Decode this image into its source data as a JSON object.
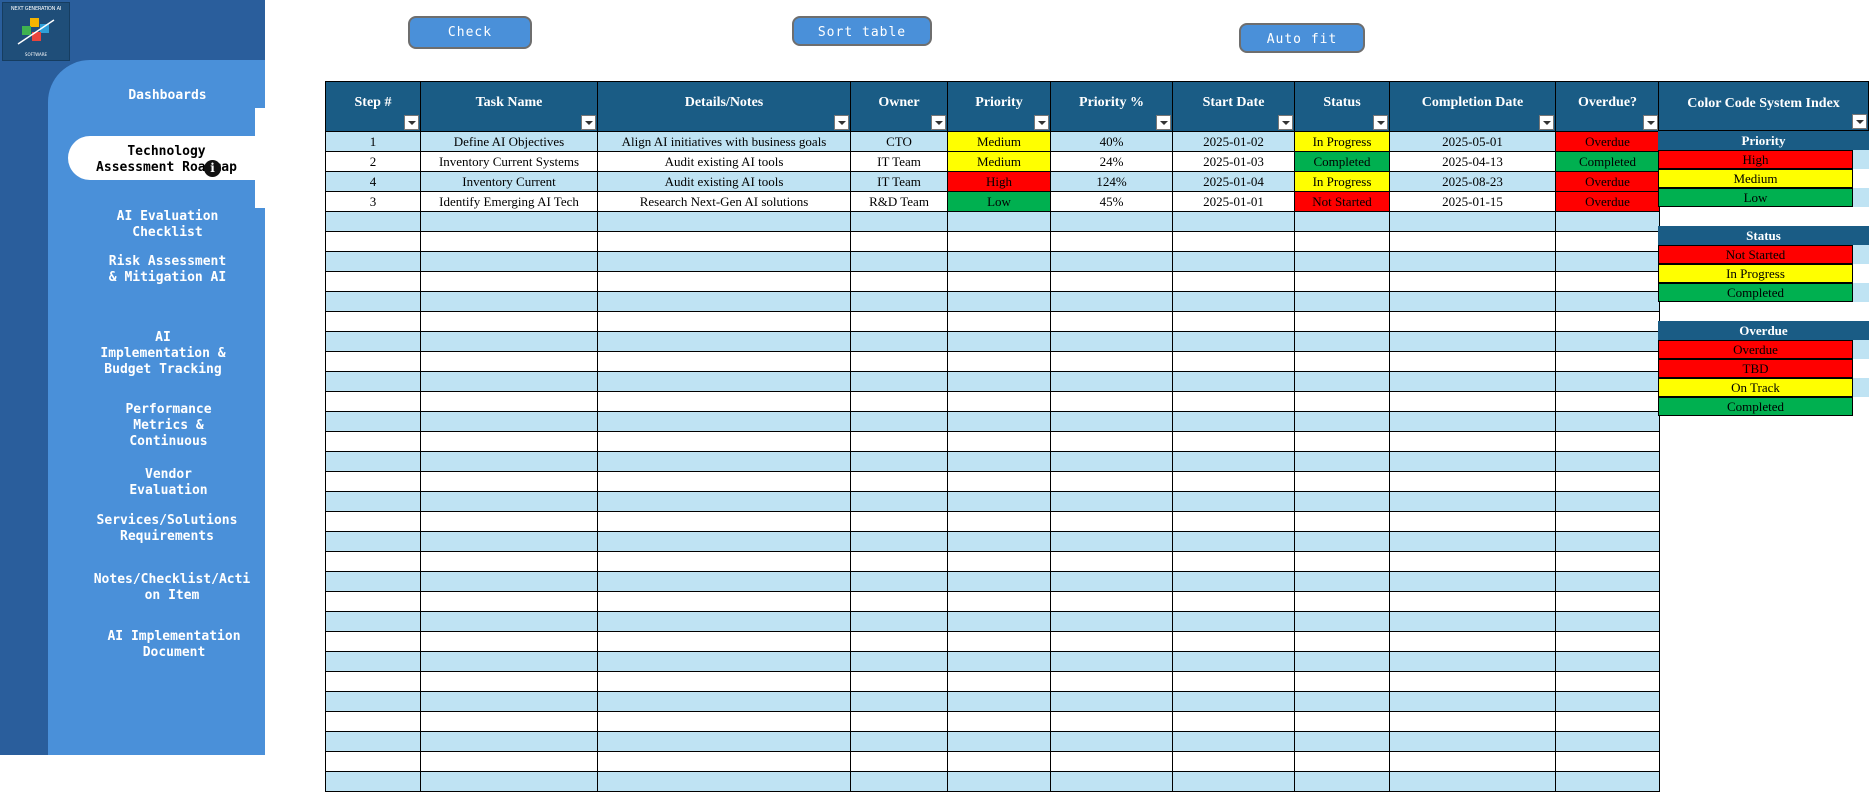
{
  "logo": {
    "top_text": "NEXT GENERATION AI",
    "bottom_text": "SOFTWARE"
  },
  "sidebar": {
    "items": [
      {
        "label": "Dashboards"
      },
      {
        "label": "Technology\nAssessment Roadmap"
      },
      {
        "label": "AI Evaluation\nChecklist"
      },
      {
        "label": "Risk Assessment\n& Mitigation AI"
      },
      {
        "label": "AI\nImplementation &\nBudget Tracking"
      },
      {
        "label": "Performance\nMetrics &\nContinuous"
      },
      {
        "label": "Vendor\nEvaluation"
      },
      {
        "label": "Services/Solutions\nRequirements"
      },
      {
        "label": "Notes/Checklist/Acti\non Item"
      },
      {
        "label": "AI Implementation\nDocument"
      }
    ]
  },
  "toolbar": {
    "check_label": "Check",
    "sort_label": "Sort table",
    "autofit_label": "Auto fit"
  },
  "table": {
    "headers": [
      "Step #",
      "Task Name",
      "Details/Notes",
      "Owner",
      "Priority",
      "Priority %",
      "Start Date",
      "Status",
      "Completion Date",
      "Overdue?"
    ],
    "rows": [
      [
        "1",
        "Define AI Objectives",
        "Align AI initiatives with business goals",
        "CTO",
        "Medium",
        "40%",
        "2025-01-02",
        "In Progress",
        "2025-05-01",
        "Overdue"
      ],
      [
        "2",
        "Inventory Current Systems",
        "Audit existing AI tools",
        "IT Team",
        "Medium",
        "24%",
        "2025-01-03",
        "Completed",
        "2025-04-13",
        "Completed"
      ],
      [
        "4",
        "Inventory Current",
        "Audit existing AI tools",
        "IT Team",
        "High",
        "124%",
        "2025-01-04",
        "In Progress",
        "2025-08-23",
        "Overdue"
      ],
      [
        "3",
        "Identify Emerging AI Tech",
        "Research Next-Gen AI solutions",
        "R&D Team",
        "Low",
        "45%",
        "2025-01-01",
        "Not Started",
        "2025-01-15",
        "Overdue"
      ]
    ]
  },
  "legend": {
    "title": "Color Code System Index",
    "priority_title": "Priority",
    "priority": [
      "High",
      "Medium",
      "Low"
    ],
    "status_title": "Status",
    "status": [
      "Not Started",
      "In Progress",
      "Completed"
    ],
    "overdue_title": "Overdue",
    "overdue": [
      "Overdue",
      "TBD",
      "On Track",
      "Completed"
    ]
  },
  "colors": {
    "red": "#ff0000",
    "yellow": "#ffff00",
    "green": "#00b050",
    "header": "#1a5c85",
    "band": "#bfe3f3",
    "sidebar": "#4a90d9"
  }
}
